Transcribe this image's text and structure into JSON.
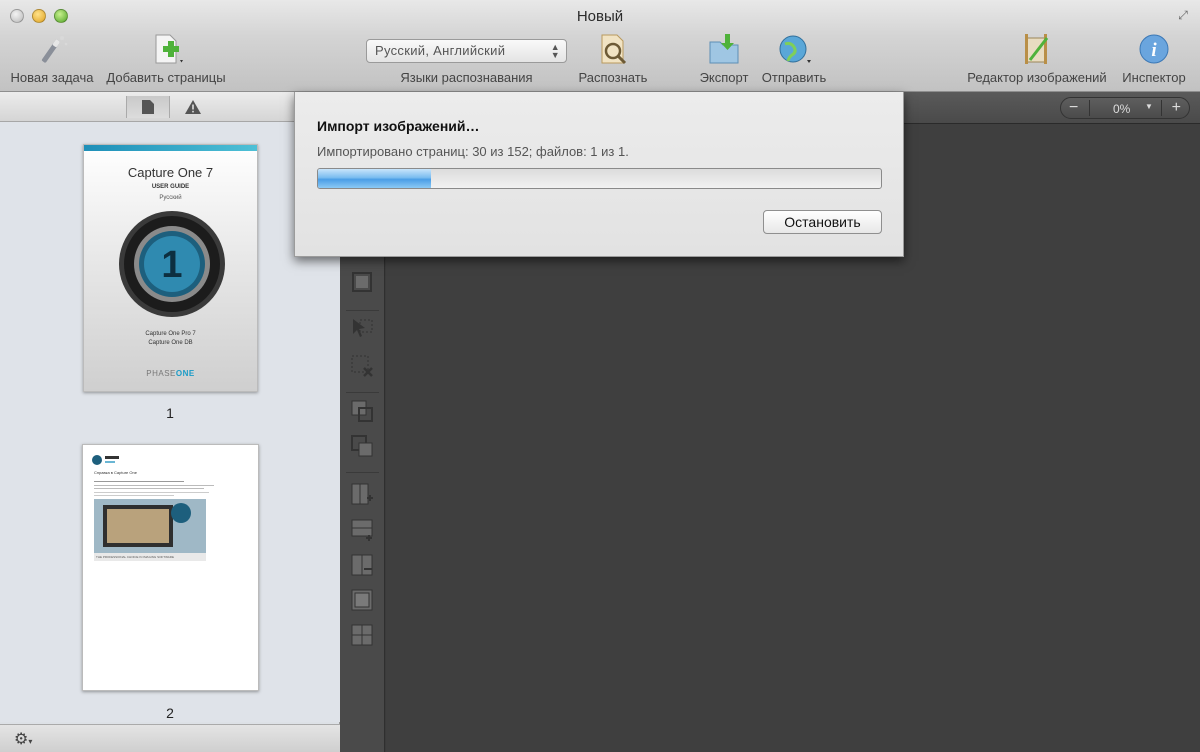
{
  "window": {
    "title": "Новый"
  },
  "toolbar": {
    "new_task": "Новая задача",
    "add_pages": "Добавить страницы",
    "language_select": "Русский, Английский",
    "language_label": "Языки распознавания",
    "recognize": "Распознать",
    "export": "Экспорт",
    "send": "Отправить",
    "image_editor": "Редактор изображений",
    "inspector": "Инспектор"
  },
  "sidebar": {
    "thumbnails": [
      {
        "page_number": "1",
        "cover_title": "Capture One 7",
        "cover_subtitle": "USER GUIDE",
        "cover_language": "Русский",
        "cover_product_1": "Capture One Pro 7",
        "cover_product_2": "Capture One DB",
        "cover_brand_light": "PHASE",
        "cover_brand_bold": "ONE"
      },
      {
        "page_number": "2",
        "heading": "Справка в Capture One",
        "banner_text": "THE PROFESSIONAL CHOICE IN IMAGING SOFTWARE"
      }
    ]
  },
  "zoom": {
    "value": "0%"
  },
  "dialog": {
    "title": "Импорт изображений…",
    "status": "Импортировано страниц: 30 из 152; файлов: 1 из 1.",
    "progress": 0.2,
    "stop_label": "Остановить"
  },
  "colors": {
    "accent": "#4b9ee6",
    "brand": "#1a9bc7"
  }
}
